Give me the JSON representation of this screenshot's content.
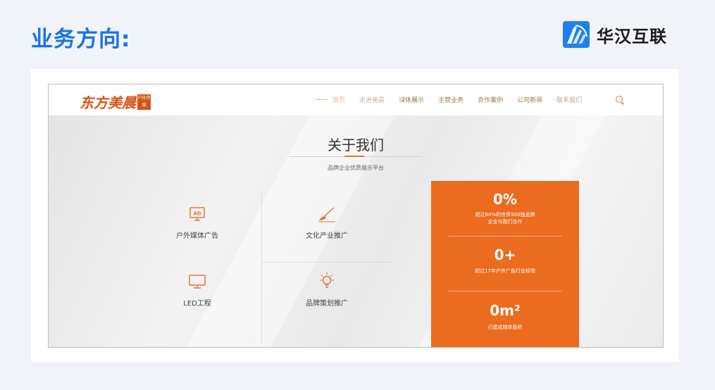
{
  "heading": "业务方向:",
  "brand": {
    "name": "华汉互联"
  },
  "site": {
    "logo": {
      "text": "东方美晨",
      "seal": "户外传媒"
    },
    "nav": [
      "首页",
      "走进美晨",
      "媒体展示",
      "主营业务",
      "合作案例",
      "公司新闻",
      "联系我们"
    ],
    "about": {
      "title": "关于我们",
      "subtitle": "品牌企业优质展示平台"
    },
    "services": [
      {
        "label": "户外媒体广告",
        "icon": "ad-board-icon"
      },
      {
        "label": "文化产业推广",
        "icon": "brush-icon"
      },
      {
        "label": "LED工程",
        "icon": "monitor-icon"
      },
      {
        "label": "品牌策划推广",
        "icon": "lightbulb-icon"
      }
    ],
    "stats": [
      {
        "num": "0%",
        "desc": [
          "超过80%的世界500强品牌",
          "企业与我们合作"
        ]
      },
      {
        "num": "0+",
        "desc": [
          "超过17年户外广告行业经验"
        ]
      },
      {
        "num": "0m²",
        "desc": [
          "已建成媒体面积"
        ]
      }
    ]
  },
  "colors": {
    "heading": "#1a73e8",
    "accent": "#eb6c1f",
    "brand": "#1f7ff0"
  }
}
